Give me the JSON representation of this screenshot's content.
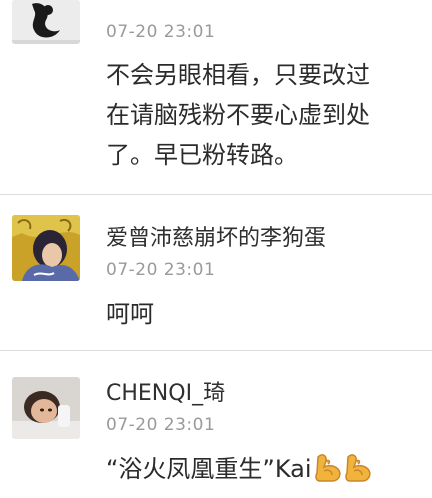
{
  "comments": [
    {
      "username": "",
      "time": "07-20 23:01",
      "lines": [
        "不会另眼相看，只要改过",
        "在请脑残粉不要心虚到处",
        "了。早已粉转路。"
      ]
    },
    {
      "username": "爱曾沛慈崩坏的李狗蛋",
      "time": "07-20 23:01",
      "lines": [
        "呵呵"
      ]
    },
    {
      "username": "CHENQI_琦",
      "time": "07-20 23:01",
      "lines": [
        "“浴火凤凰重生”Kai"
      ],
      "emojis": [
        "flexed-biceps",
        "flexed-biceps"
      ]
    }
  ]
}
